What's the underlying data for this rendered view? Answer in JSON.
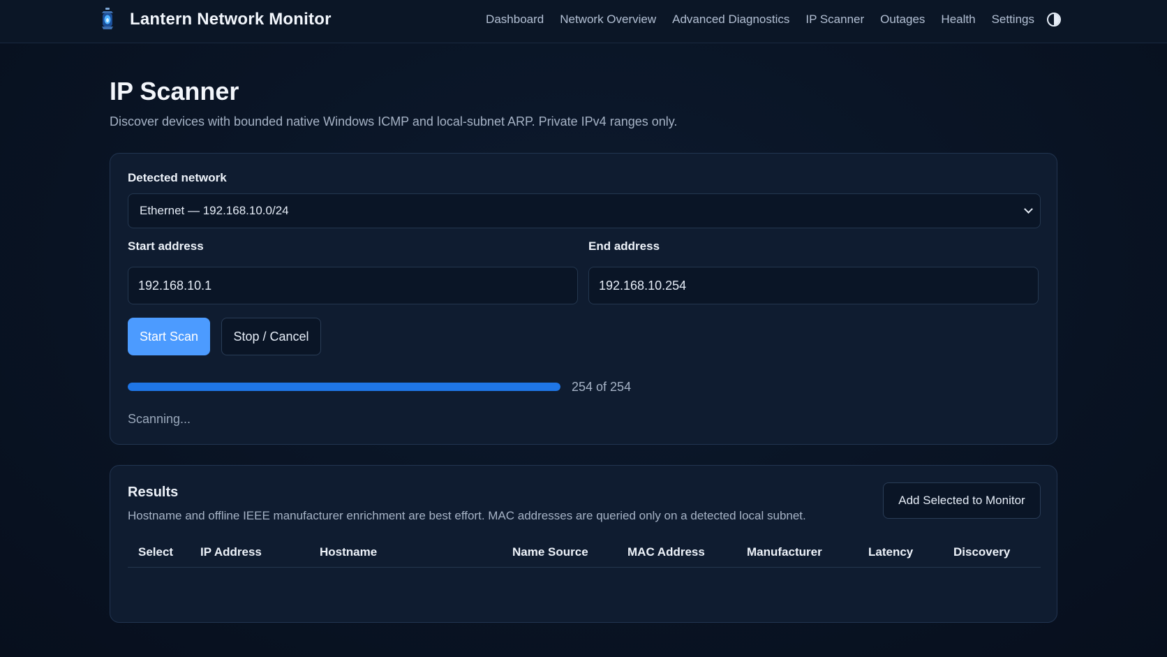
{
  "app": {
    "title": "Lantern Network Monitor",
    "logo_icon": "lantern-icon"
  },
  "nav": {
    "items": [
      {
        "label": "Dashboard"
      },
      {
        "label": "Network Overview"
      },
      {
        "label": "Advanced Diagnostics"
      },
      {
        "label": "IP Scanner"
      },
      {
        "label": "Outages"
      },
      {
        "label": "Health"
      },
      {
        "label": "Settings"
      }
    ],
    "theme_toggle_icon": "contrast-icon"
  },
  "page": {
    "title": "IP Scanner",
    "subtitle": "Discover devices with bounded native Windows ICMP and local-subnet ARP. Private IPv4 ranges only."
  },
  "scan": {
    "network_label": "Detected network",
    "network_value": "Ethernet — 192.168.10.0/24",
    "start_label": "Start address",
    "start_value": "192.168.10.1",
    "end_label": "End address",
    "end_value": "192.168.10.254",
    "start_button": "Start Scan",
    "stop_button": "Stop / Cancel",
    "progress_fraction": 1.0,
    "progress_text": "254 of 254",
    "status_text": "Scanning..."
  },
  "results": {
    "title": "Results",
    "subtitle": "Hostname and offline IEEE manufacturer enrichment are best effort. MAC addresses are queried only on a detected local subnet.",
    "add_button": "Add Selected to Monitor",
    "columns": [
      "Select",
      "IP Address",
      "Hostname",
      "Name Source",
      "MAC Address",
      "Manufacturer",
      "Latency",
      "Discovery"
    ],
    "rows": []
  },
  "colors": {
    "accent": "#4c9bff",
    "progress": "#1f76e6",
    "background": "#0a1526",
    "card": "#0f1c30"
  }
}
